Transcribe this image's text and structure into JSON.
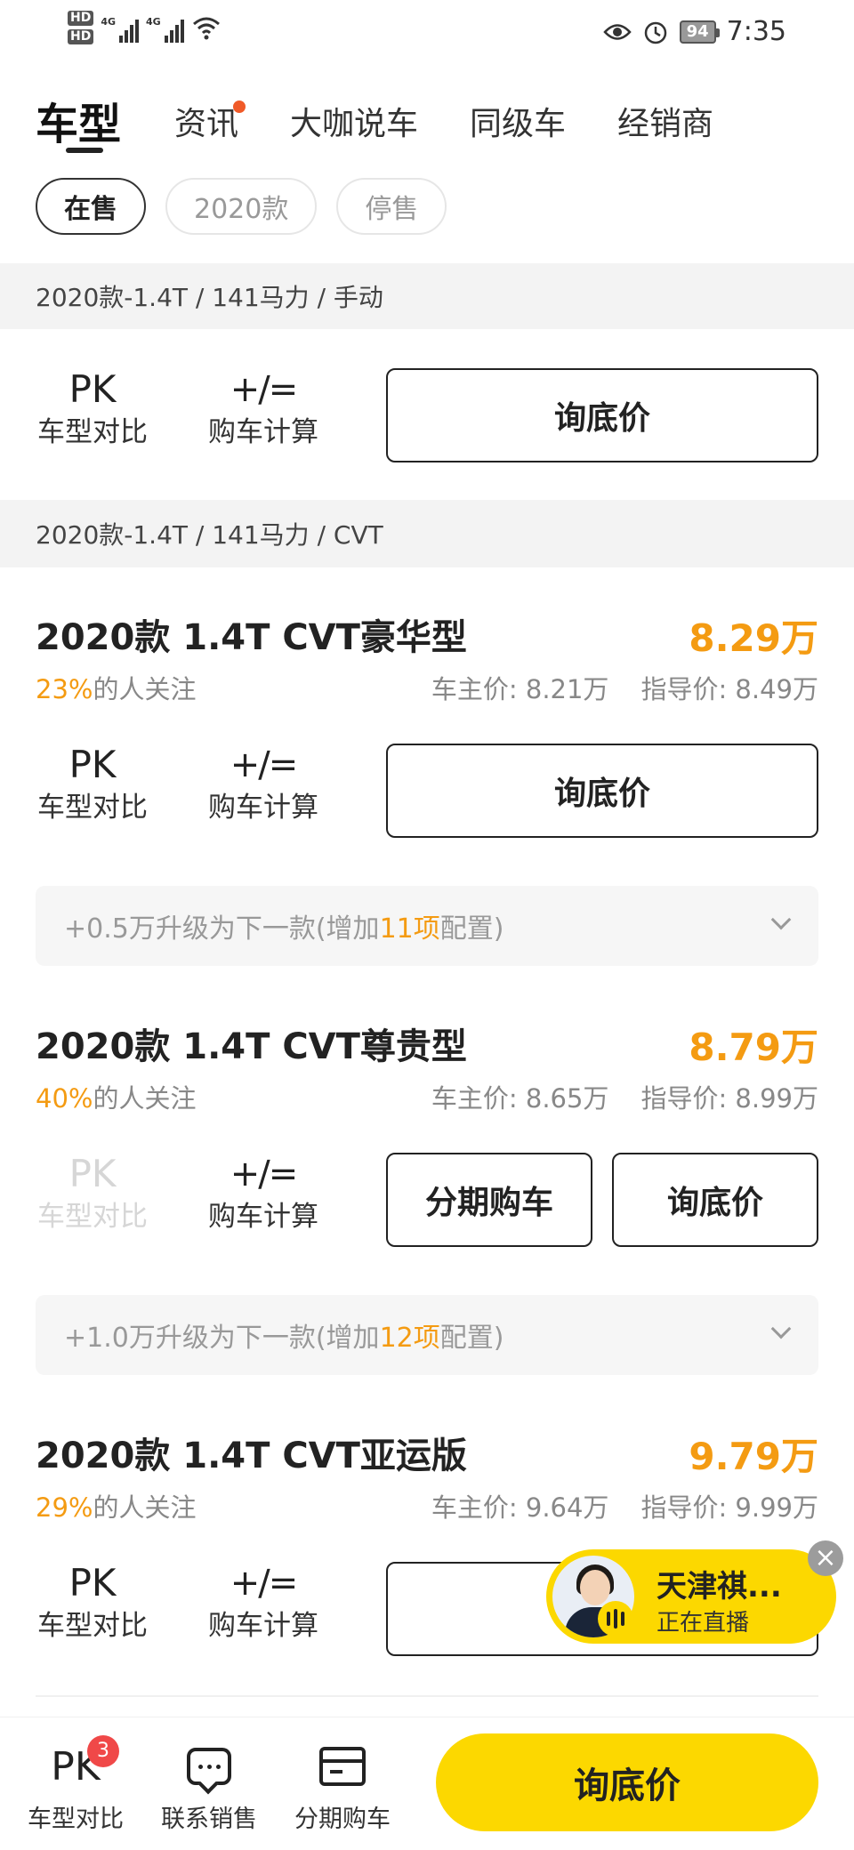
{
  "status_bar": {
    "hd1": "HD",
    "hd2": "HD",
    "net1": "4G",
    "net2": "4G",
    "battery": "94",
    "time": "7:35"
  },
  "tabs": [
    {
      "label": "车型",
      "active": true
    },
    {
      "label": "资讯",
      "has_dot": true
    },
    {
      "label": "大咖说车"
    },
    {
      "label": "同级车"
    },
    {
      "label": "经销商"
    }
  ],
  "filters": [
    {
      "label": "在售",
      "active": true
    },
    {
      "label": "2020款"
    },
    {
      "label": "停售"
    }
  ],
  "groups": [
    {
      "header": "2020款-1.4T / 141马力 / 手动"
    },
    {
      "header": "2020款-1.4T / 141马力 / CVT"
    }
  ],
  "actions": {
    "pk_icon": "PK",
    "pk_label": "车型对比",
    "calc_icon": "+∕=",
    "calc_label": "购车计算",
    "inquire": "询底价",
    "installment": "分期购车"
  },
  "models": [
    {
      "title": "2020款 1.4T CVT豪华型",
      "price": "8.29",
      "price_unit": "万",
      "attention_pct": "23%",
      "attention_text": "的人关注",
      "owner_price": "车主价: 8.21万",
      "guide_price": "指导价: 8.49万",
      "upgrade": {
        "prefix": "+0.5万升级为下一款(增加",
        "count": "11项",
        "suffix": "配置)"
      }
    },
    {
      "title": "2020款 1.4T CVT尊贵型",
      "price": "8.79",
      "price_unit": "万",
      "attention_pct": "40%",
      "attention_text": "的人关注",
      "owner_price": "车主价: 8.65万",
      "guide_price": "指导价: 8.99万",
      "upgrade": {
        "prefix": "+1.0万升级为下一款(增加",
        "count": "12项",
        "suffix": "配置)"
      }
    },
    {
      "title": "2020款 1.4T CVT亚运版",
      "price": "9.79",
      "price_unit": "万",
      "attention_pct": "29%",
      "attention_text": "的人关注",
      "owner_price": "车主价: 9.64万",
      "guide_price": "指导价: 9.99万"
    }
  ],
  "live": {
    "name": "天津祺...",
    "status": "正在直播",
    "close": "×"
  },
  "bottom_bar": {
    "compare_icon": "PK",
    "compare_badge": "3",
    "compare_label": "车型对比",
    "contact_label": "联系销售",
    "installment_label": "分期购车",
    "cta": "询底价"
  },
  "colors": {
    "accent_yellow": "#fcd800",
    "price_orange": "#f49b12",
    "badge_red": "#f04848",
    "tab_dot": "#f05a28"
  }
}
